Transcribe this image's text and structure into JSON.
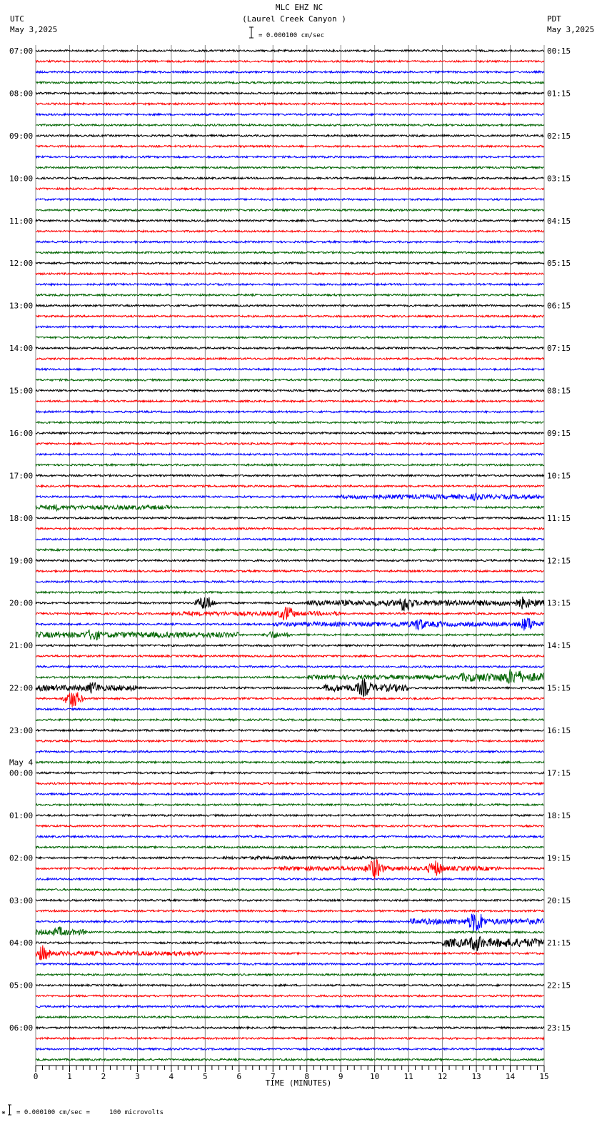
{
  "header": {
    "station": "MLC EHZ NC",
    "location": "(Laurel Creek Canyon )",
    "left_tz": "UTC",
    "left_date": "May 3,2025",
    "right_tz": "PDT",
    "right_date": "May 3,2025",
    "scale": "= 0.000100 cm/sec"
  },
  "footer": {
    "scale_note": "= 0.000100 cm/sec =     100 microvolts"
  },
  "chart_data": {
    "type": "line",
    "title": "MLC EHZ NC (Laurel Creek Canyon )",
    "xlabel": "TIME (MINUTES)",
    "xlim": [
      0,
      15
    ],
    "x_ticks": [
      "0",
      "1",
      "2",
      "3",
      "4",
      "5",
      "6",
      "7",
      "8",
      "9",
      "10",
      "11",
      "12",
      "13",
      "14",
      "15"
    ],
    "trace_count": 96,
    "trace_minutes": 15,
    "colors": [
      "#000000",
      "#ff0000",
      "#0000ff",
      "#006400"
    ],
    "utc_labels": [
      "07:00",
      "08:00",
      "09:00",
      "10:00",
      "11:00",
      "12:00",
      "13:00",
      "14:00",
      "15:00",
      "16:00",
      "17:00",
      "18:00",
      "19:00",
      "20:00",
      "21:00",
      "22:00",
      "23:00",
      "00:00",
      "01:00",
      "02:00",
      "03:00",
      "04:00",
      "05:00",
      "06:00"
    ],
    "date_change_label": "May 4",
    "pdt_labels": [
      "00:15",
      "01:15",
      "02:15",
      "03:15",
      "04:15",
      "05:15",
      "06:15",
      "07:15",
      "08:15",
      "09:15",
      "10:15",
      "11:15",
      "12:15",
      "13:15",
      "14:15",
      "15:15",
      "16:15",
      "17:15",
      "18:15",
      "19:15",
      "20:15",
      "21:15",
      "22:15",
      "23:15"
    ],
    "events": [
      {
        "trace": 42,
        "start": 9,
        "end": 15,
        "amp": 3,
        "peak": 13,
        "peak_amp": 6
      },
      {
        "trace": 43,
        "start": 0,
        "end": 4,
        "amp": 3,
        "peak": 0.6,
        "peak_amp": 5
      },
      {
        "trace": 52,
        "start": 8,
        "end": 15,
        "amp": 4,
        "peak": 10.9,
        "peak_amp": 14
      },
      {
        "trace": 52,
        "start": 14,
        "end": 14.8,
        "amp": 5,
        "peak": 14.4,
        "peak_amp": 10
      },
      {
        "trace": 52,
        "start": 4.9,
        "end": 5.1,
        "amp": 2,
        "peak": 5,
        "peak_amp": 12
      },
      {
        "trace": 53,
        "start": 4,
        "end": 9,
        "amp": 3,
        "peak": 7.4,
        "peak_amp": 12
      },
      {
        "trace": 54,
        "start": 7,
        "end": 15,
        "amp": 3,
        "peak": 14.5,
        "peak_amp": 12
      },
      {
        "trace": 54,
        "start": 10.5,
        "end": 12,
        "amp": 4,
        "peak": 11.3,
        "peak_amp": 10
      },
      {
        "trace": 55,
        "start": 0,
        "end": 6,
        "amp": 4,
        "peak": 1.7,
        "peak_amp": 10
      },
      {
        "trace": 55,
        "start": 6.8,
        "end": 7.5,
        "amp": 3,
        "peak": 7,
        "peak_amp": 6
      },
      {
        "trace": 59,
        "start": 8,
        "end": 15,
        "amp": 3,
        "peak": 14,
        "peak_amp": 12
      },
      {
        "trace": 59,
        "start": 12.5,
        "end": 15,
        "amp": 6,
        "peak": 14.2,
        "peak_amp": 12
      },
      {
        "trace": 60,
        "start": 0,
        "end": 3,
        "amp": 4,
        "peak": 1.7,
        "peak_amp": 10
      },
      {
        "trace": 60,
        "start": 8.5,
        "end": 11,
        "amp": 5,
        "peak": 9.7,
        "peak_amp": 14
      },
      {
        "trace": 61,
        "start": 1,
        "end": 1.2,
        "amp": 2,
        "peak": 1.1,
        "peak_amp": 14
      },
      {
        "trace": 76,
        "start": 5.5,
        "end": 10,
        "amp": 2,
        "peak": 6.5,
        "peak_amp": 3
      },
      {
        "trace": 77,
        "start": 7,
        "end": 13.7,
        "amp": 3,
        "peak": 10,
        "peak_amp": 16
      },
      {
        "trace": 77,
        "start": 11.7,
        "end": 11.9,
        "amp": 2,
        "peak": 11.8,
        "peak_amp": 12
      },
      {
        "trace": 82,
        "start": 11,
        "end": 15,
        "amp": 4,
        "peak": 13,
        "peak_amp": 18
      },
      {
        "trace": 83,
        "start": 0,
        "end": 1.5,
        "amp": 4,
        "peak": 0.7,
        "peak_amp": 8
      },
      {
        "trace": 84,
        "start": 12,
        "end": 15,
        "amp": 6,
        "peak": 13,
        "peak_amp": 14
      },
      {
        "trace": 85,
        "start": 0,
        "end": 5,
        "amp": 3,
        "peak": 0.2,
        "peak_amp": 12
      }
    ]
  }
}
